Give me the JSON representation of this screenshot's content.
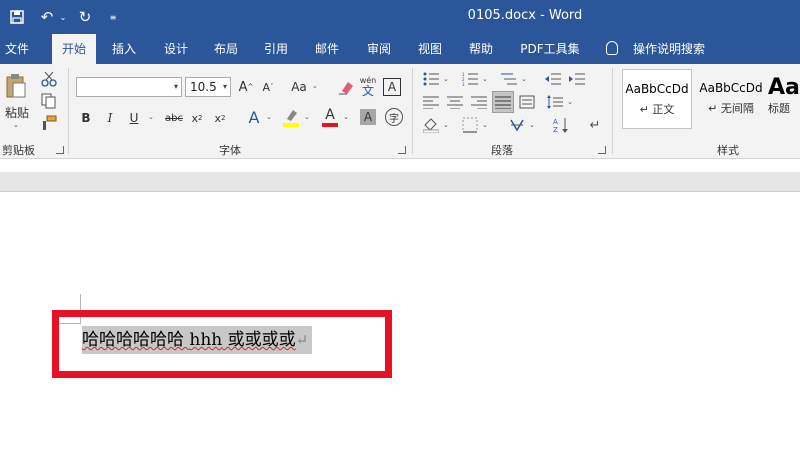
{
  "titlebar": {
    "title": "0105.docx  -  Word"
  },
  "tabs": [
    {
      "label": "文件"
    },
    {
      "label": "开始"
    },
    {
      "label": "插入"
    },
    {
      "label": "设计"
    },
    {
      "label": "布局"
    },
    {
      "label": "引用"
    },
    {
      "label": "邮件"
    },
    {
      "label": "审阅"
    },
    {
      "label": "视图"
    },
    {
      "label": "帮助"
    },
    {
      "label": "PDF工具集"
    },
    {
      "label": "操作说明搜索"
    }
  ],
  "ribbon": {
    "clipboard": {
      "paste_label": "粘贴",
      "group_label": "剪贴板"
    },
    "font": {
      "font_name": "",
      "font_size": "10.5",
      "group_label": "字体",
      "change_case": "Aa",
      "pinyin": "wén",
      "pinyin_char": "文",
      "border_char": "A",
      "enclose_char": "字"
    },
    "paragraph": {
      "group_label": "段落"
    },
    "styles": {
      "group_label": "样式",
      "items": [
        {
          "preview": "AaBbCcDd",
          "name": "↵ 正文"
        },
        {
          "preview": "AaBbCcDd",
          "name": "↵ 无间隔"
        },
        {
          "preview": "Aa",
          "name": "标题"
        }
      ]
    }
  },
  "document": {
    "text_part1": "哈哈哈哈哈哈 ",
    "text_part2": "hhh",
    "text_part3": " 或或或或",
    "para_mark": "↵"
  },
  "colors": {
    "title_bar": "#2b579a",
    "highlight_border": "#e81123",
    "selection": "#c8c8c8"
  }
}
